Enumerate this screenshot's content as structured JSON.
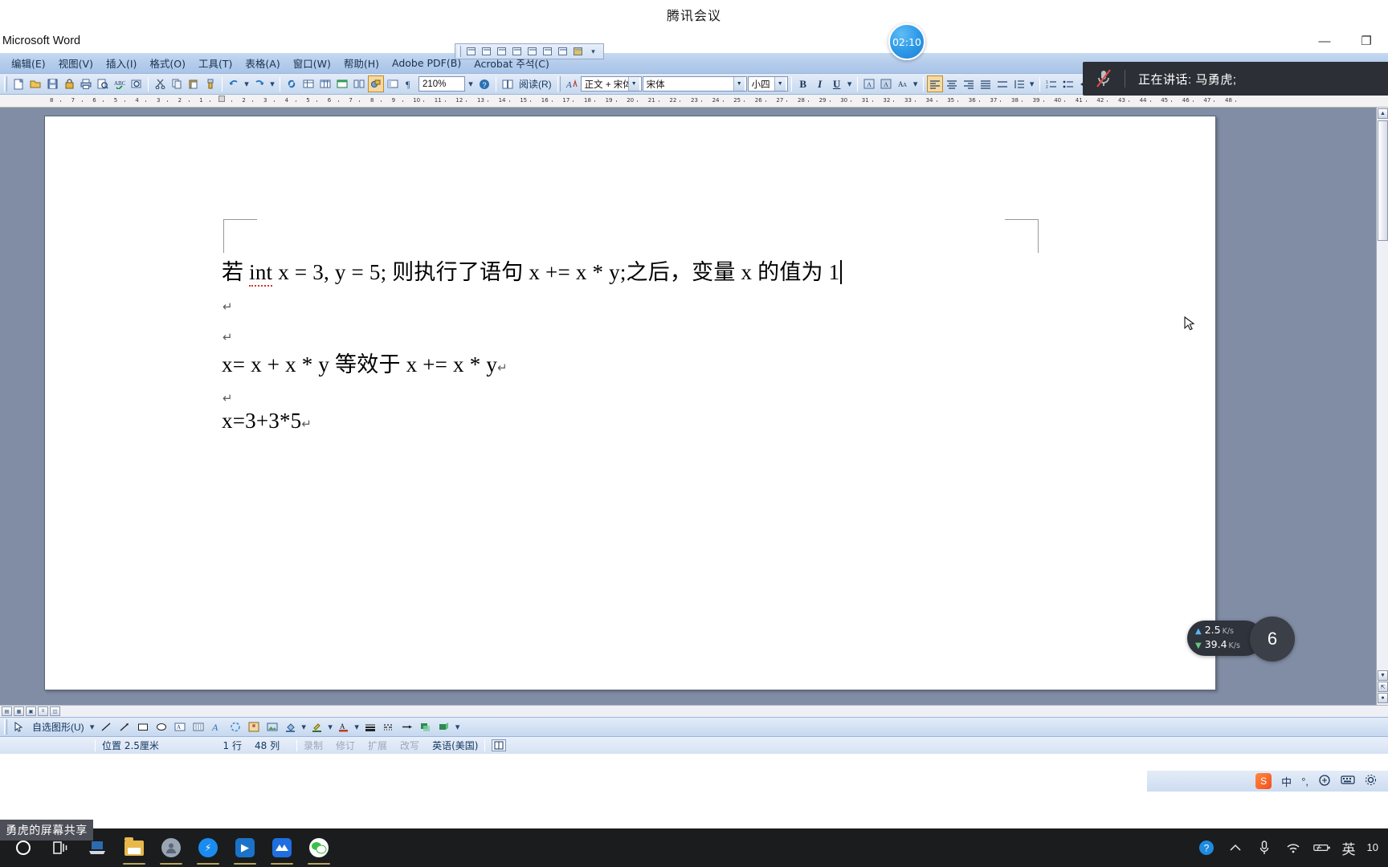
{
  "meeting": {
    "app_title": "腾讯会议",
    "timer": "02:10",
    "speaking_label": "正在讲话: 马勇虎;",
    "mic_icon": "microphone-muted-icon",
    "share_banner": "勇虎的屏幕共享"
  },
  "word": {
    "titlebar": {
      "title": "- Microsoft Word",
      "minimize": "—",
      "restore": "❐",
      "close": "✕"
    },
    "menu": [
      {
        "label": "编辑(E)"
      },
      {
        "label": "视图(V)"
      },
      {
        "label": "插入(I)"
      },
      {
        "label": "格式(O)"
      },
      {
        "label": "工具(T)"
      },
      {
        "label": "表格(A)"
      },
      {
        "label": "窗口(W)"
      },
      {
        "label": "帮助(H)"
      },
      {
        "label": "Adobe PDF(B)"
      },
      {
        "label": "Acrobat 주석(C)"
      }
    ],
    "toolbar": {
      "zoom_value": "210%",
      "read_label": "阅读(R)",
      "style_value": "正文 + 宋体",
      "font_value": "宋体",
      "size_value": "小四",
      "bold": "B",
      "italic": "I",
      "underline": "U",
      "icons": [
        "new-document-icon",
        "open-icon",
        "save-icon",
        "permission-icon",
        "print-icon",
        "print-preview-icon",
        "spellcheck-icon",
        "research-icon",
        "cut-icon",
        "copy-icon",
        "paste-icon",
        "format-painter-icon",
        "undo-icon",
        "redo-icon",
        "hyperlink-icon",
        "tables-borders-icon",
        "insert-table-icon",
        "insert-excel-icon",
        "columns-icon",
        "drawing-icon",
        "document-map-icon",
        "show-formatting-icon"
      ],
      "paragraph_icons": [
        "align-left-icon",
        "align-center-icon",
        "align-right-icon",
        "justify-icon",
        "line-spacing-icon",
        "numbered-list-icon",
        "bulleted-list-icon",
        "decrease-indent-icon",
        "increase-indent-icon",
        "outside-border-icon",
        "highlight-icon",
        "font-color-icon"
      ]
    },
    "ruler": {
      "ticks": [
        "8",
        "7",
        "6",
        "5",
        "4",
        "3",
        "2",
        "1",
        "1",
        "2",
        "3",
        "4",
        "5",
        "6",
        "7",
        "8",
        "9",
        "10",
        "11",
        "12",
        "13",
        "14",
        "15",
        "16",
        "17",
        "18",
        "19",
        "20",
        "21",
        "22",
        "23",
        "24",
        "25",
        "26",
        "27",
        "28",
        "29",
        "30",
        "31",
        "32",
        "33",
        "34",
        "35",
        "36",
        "37",
        "38",
        "39",
        "40",
        "41",
        "42",
        "43",
        "44",
        "45",
        "46",
        "47",
        "48"
      ]
    },
    "document": {
      "line1_a": "若 ",
      "line1_spell": "int",
      "line1_b": " x = 3, y = 5;  则执行了语句  x += x * y;之后，变量 x 的值为 1",
      "line3": "x= x + x * y    等效于 x += x * y",
      "line5": "x=3+3*5",
      "pilcrow": "↵"
    },
    "drawing_toolbar": {
      "autoshapes_label": "自选图形(U)",
      "icons": [
        "select-objects-icon",
        "line-icon",
        "arrow-icon",
        "rectangle-icon",
        "oval-icon",
        "text-box-icon",
        "vertical-text-box-icon",
        "wordart-icon",
        "diagram-icon",
        "clip-art-icon",
        "insert-picture-icon",
        "fill-color-icon",
        "line-color-icon",
        "font-color-icon",
        "line-style-icon",
        "dash-style-icon",
        "arrow-style-icon",
        "shadow-style-icon",
        "3d-style-icon"
      ]
    },
    "statusbar": {
      "position": "位置 2.5厘米",
      "line": "1 行",
      "column": "48 列",
      "rec": "录制",
      "trk": "修订",
      "ext": "扩展",
      "ovr": "改写",
      "language": "英语(美国)",
      "spellcheck_icon": "spellcheck-status-icon"
    }
  },
  "network": {
    "upload": "2.5",
    "upload_unit": "K/s",
    "download": "39.4",
    "download_unit": "K/s",
    "ball_label": "6"
  },
  "ime": {
    "logo": "S",
    "mode": "中",
    "icons": [
      "half-width-icon",
      "punctuation-icon",
      "keyboard-icon",
      "settings-icon"
    ]
  },
  "taskbar": {
    "start_icon": "windows-start-icon",
    "taskview_icon": "task-view-icon",
    "apps": [
      {
        "name": "remote-desktop-icon"
      },
      {
        "name": "file-explorer-icon"
      },
      {
        "name": "user-app-icon"
      },
      {
        "name": "thunder-download-icon"
      },
      {
        "name": "media-player-icon"
      },
      {
        "name": "tencent-meeting-icon"
      },
      {
        "name": "wechat-icon"
      }
    ],
    "tray": {
      "help_icon": "help-icon",
      "chevron_icon": "chevron-up-icon",
      "mic_icon": "microphone-icon",
      "wifi_icon": "wifi-icon",
      "battery_icon": "battery-icon",
      "ime_label": "英",
      "clock": "10"
    }
  }
}
